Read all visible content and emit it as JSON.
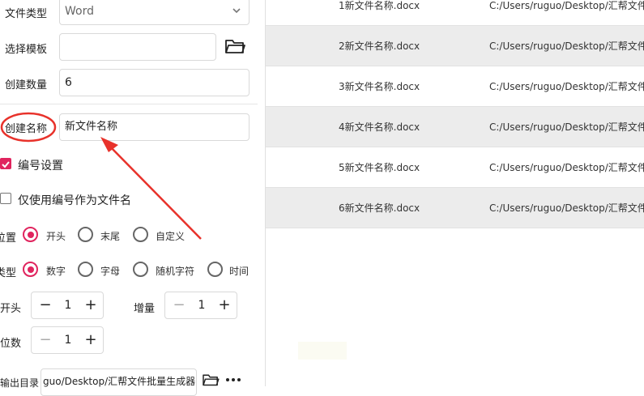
{
  "form": {
    "file_type_label": "文件类型",
    "file_type_value": "Word",
    "template_label": "选择模板",
    "template_value": "",
    "count_label": "创建数量",
    "count_value": "6",
    "name_label": "创建名称",
    "name_value": "新文件名称",
    "numbering_label": "编号设置",
    "numbering_checked": true,
    "only_number_label": "仅使用编号作为文件名",
    "only_number_checked": false,
    "position_label": "位置",
    "position_options": [
      "开头",
      "末尾",
      "自定义"
    ],
    "position_selected": "开头",
    "type_label": "类型",
    "type_options": [
      "数字",
      "字母",
      "随机字符",
      "时间"
    ],
    "type_selected": "数字",
    "start_label": "开头",
    "start_value": "1",
    "increment_label": "增量",
    "increment_value": "1",
    "digits_label": "位数",
    "digits_value": "1",
    "output_label": "输出目录:",
    "output_value": "guo/Desktop/汇帮文件批量生成器"
  },
  "table": {
    "rows": [
      {
        "name": "1新文件名称.docx",
        "path": "C:/Users/ruguo/Desktop/汇帮文件"
      },
      {
        "name": "2新文件名称.docx",
        "path": "C:/Users/ruguo/Desktop/汇帮文件"
      },
      {
        "name": "3新文件名称.docx",
        "path": "C:/Users/ruguo/Desktop/汇帮文件"
      },
      {
        "name": "4新文件名称.docx",
        "path": "C:/Users/ruguo/Desktop/汇帮文件"
      },
      {
        "name": "5新文件名称.docx",
        "path": "C:/Users/ruguo/Desktop/汇帮文件"
      },
      {
        "name": "6新文件名称.docx",
        "path": "C:/Users/ruguo/Desktop/汇帮文件"
      }
    ]
  },
  "annotation": {
    "color": "#e8322b"
  },
  "icons": {
    "dropdown": "chevron-down-icon",
    "folder": "folder-icon",
    "more": "more-icon",
    "checkbox_checked": "checkmark-icon",
    "minus": "minus-icon",
    "plus": "plus-icon"
  },
  "colors": {
    "accent": "#e0245e",
    "row_alt": "#ececec"
  }
}
